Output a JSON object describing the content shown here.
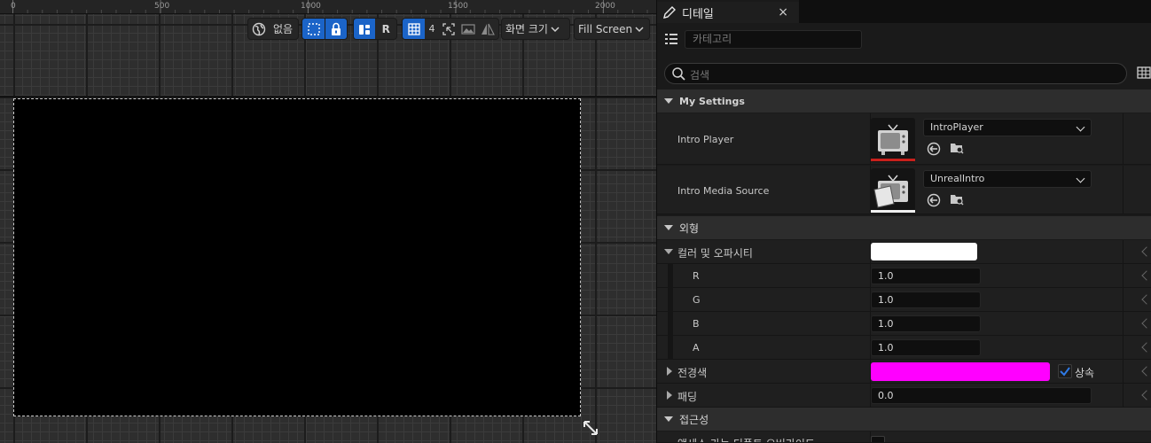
{
  "ruler": {
    "ticks": [
      "0",
      "500",
      "1000",
      "1500",
      "2000"
    ]
  },
  "toolbar": {
    "locale_label": "없음",
    "r_label": "R",
    "grid_snap_value": "4",
    "screen_size_label": "화면 크기",
    "fill_screen_label": "Fill Screen"
  },
  "details": {
    "tab_title": "디테일",
    "close_glyph": "×",
    "category_placeholder": "카테고리",
    "search_placeholder": "검색",
    "sections": {
      "my_settings": "My Settings",
      "appearance": "외형",
      "accessibility": "접근성"
    },
    "intro_player": {
      "label": "Intro Player",
      "value": "IntroPlayer"
    },
    "intro_media_source": {
      "label": "Intro Media Source",
      "value": "UnrealIntro"
    },
    "color_opacity": {
      "label": "컬러 및 오파시티",
      "swatch": "#ffffff"
    },
    "channels": [
      {
        "label": "R",
        "value": "1.0"
      },
      {
        "label": "G",
        "value": "1.0"
      },
      {
        "label": "B",
        "value": "1.0"
      },
      {
        "label": "A",
        "value": "1.0"
      }
    ],
    "background_color": {
      "label": "전경색",
      "swatch": "#ff00ff",
      "inherit_label": "상속",
      "inherit_checked": true
    },
    "padding": {
      "label": "패딩",
      "value": "0.0"
    },
    "accessible_override": {
      "label": "액세스 가능 디폴트 오버라이드"
    }
  },
  "colors": {
    "accent_blue": "#1b64c8",
    "checkbox_blue": "#1b64c8"
  }
}
